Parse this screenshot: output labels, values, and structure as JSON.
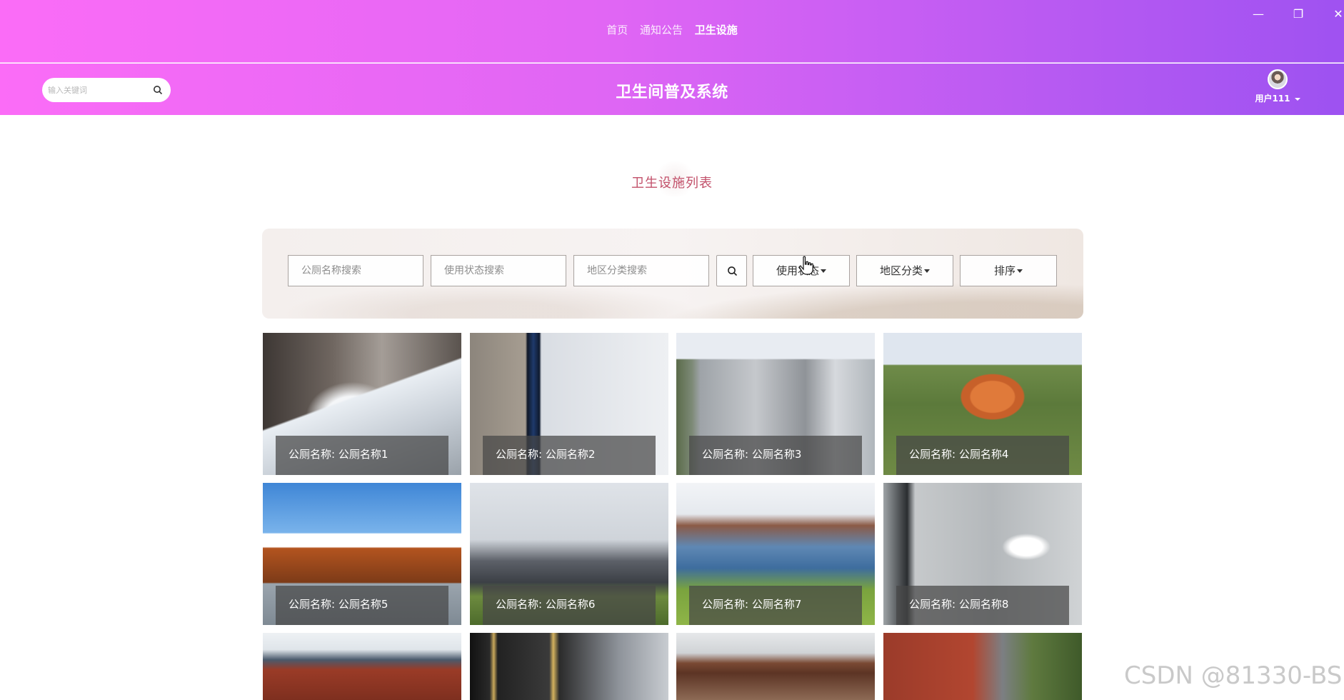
{
  "topnav": {
    "links": [
      "首页",
      "通知公告",
      "卫生设施"
    ],
    "active_index": 2
  },
  "window_controls": {
    "minimize": "—",
    "restore": "❐",
    "close": "✕"
  },
  "header": {
    "search_placeholder": "输入关键词",
    "title": "卫生间普及系统",
    "username": "用户111"
  },
  "page": {
    "section_title": "卫生设施列表"
  },
  "filters": {
    "name_placeholder": "公厕名称搜索",
    "status_placeholder": "使用状态搜索",
    "region_placeholder": "地区分类搜索",
    "dropdowns": [
      "使用状态",
      "地区分类",
      "排序"
    ]
  },
  "cards": [
    {
      "label": "公厕名称: 公厕名称1"
    },
    {
      "label": "公厕名称: 公厕名称2"
    },
    {
      "label": "公厕名称: 公厕名称3"
    },
    {
      "label": "公厕名称: 公厕名称4"
    },
    {
      "label": "公厕名称: 公厕名称5"
    },
    {
      "label": "公厕名称: 公厕名称6"
    },
    {
      "label": "公厕名称: 公厕名称7"
    },
    {
      "label": "公厕名称: 公厕名称8"
    }
  ],
  "watermark": "CSDN @81330-BS",
  "colors": {
    "gradient_start": "#fb6cf7",
    "gradient_end": "#9d52f1",
    "section_title": "#c2506a"
  }
}
